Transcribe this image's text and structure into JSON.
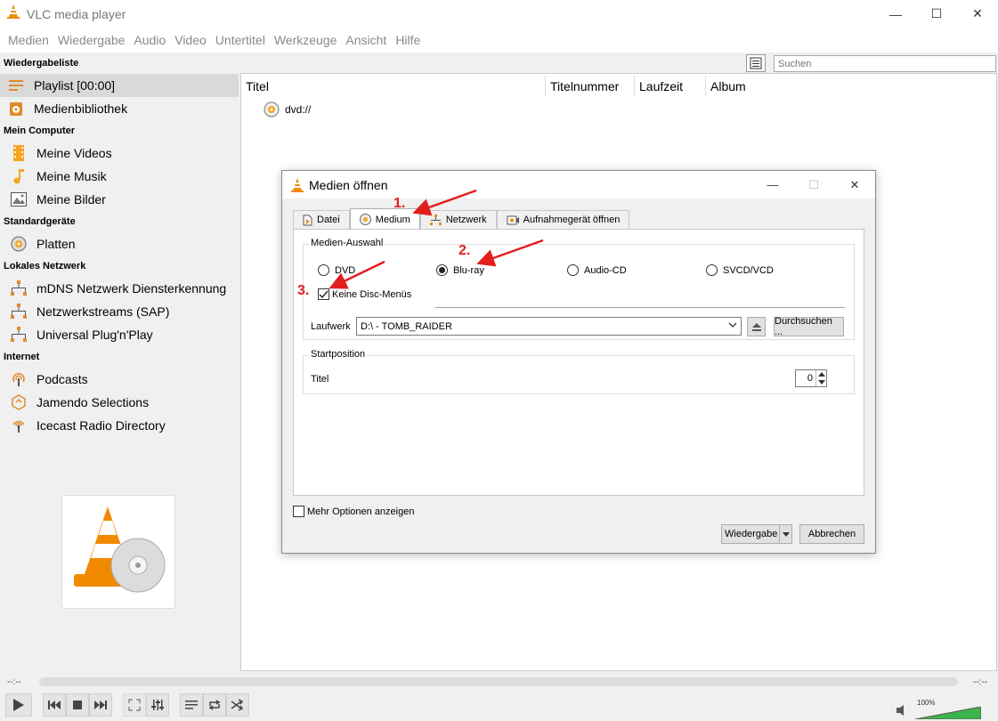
{
  "window": {
    "title": "VLC media player"
  },
  "menu": [
    "Medien",
    "Wiedergabe",
    "Audio",
    "Video",
    "Untertitel",
    "Werkzeuge",
    "Ansicht",
    "Hilfe"
  ],
  "sidebar": {
    "sections": [
      {
        "heading": "Wiedergabeliste",
        "items": [
          {
            "label": "Playlist [00:00]",
            "icon": "playlist-icon"
          },
          {
            "label": "Medienbibliothek",
            "icon": "media-library-icon"
          }
        ]
      },
      {
        "heading": "Mein Computer",
        "items": [
          {
            "label": "Meine Videos",
            "icon": "film-icon"
          },
          {
            "label": "Meine Musik",
            "icon": "music-note-icon"
          },
          {
            "label": "Meine Bilder",
            "icon": "picture-icon"
          }
        ]
      },
      {
        "heading": "Standardgeräte",
        "items": [
          {
            "label": "Platten",
            "icon": "disc-icon"
          }
        ]
      },
      {
        "heading": "Lokales Netzwerk",
        "items": [
          {
            "label": "mDNS Netzwerk Diensterkennung",
            "icon": "network-icon"
          },
          {
            "label": "Netzwerkstreams (SAP)",
            "icon": "network-icon"
          },
          {
            "label": "Universal Plug'n'Play",
            "icon": "network-icon"
          }
        ]
      },
      {
        "heading": "Internet",
        "items": [
          {
            "label": "Podcasts",
            "icon": "podcast-icon"
          },
          {
            "label": "Jamendo Selections",
            "icon": "jamendo-icon"
          },
          {
            "label": "Icecast Radio Directory",
            "icon": "radio-icon"
          }
        ]
      }
    ]
  },
  "search": {
    "placeholder": "Suchen"
  },
  "playlist": {
    "columns": [
      "Titel",
      "Titelnummer",
      "Laufzeit",
      "Album"
    ],
    "rows": [
      {
        "title": "dvd://"
      }
    ]
  },
  "timeline": {
    "elapsed": "--:--",
    "total": "--:--"
  },
  "volume": {
    "label": "100%",
    "level": 1.0
  },
  "dialog": {
    "title": "Medien öffnen",
    "tabs": [
      "Datei",
      "Medium",
      "Netzwerk",
      "Aufnahmegerät öffnen"
    ],
    "active_tab": "Medium",
    "media_group": "Medien-Auswahl",
    "disc_types": [
      "DVD",
      "Blu-ray",
      "Audio-CD",
      "SVCD/VCD"
    ],
    "selected_disc": "Blu-ray",
    "no_menus_label": "Keine Disc-Menüs",
    "no_menus_checked": true,
    "drive_label": "Laufwerk",
    "drive_value": "D:\\ - TOMB_RAIDER",
    "browse_label": "Durchsuchen ...",
    "start_group": "Startposition",
    "title_label": "Titel",
    "title_value": "0",
    "more_options_label": "Mehr Optionen anzeigen",
    "more_options_checked": false,
    "play_label": "Wiedergabe",
    "cancel_label": "Abbrechen"
  },
  "annotations": [
    "1.",
    "2.",
    "3."
  ],
  "colors": {
    "annotation": "#e31e1e",
    "vlc_orange": "#f18a00",
    "volume_green": "#3cb44b"
  }
}
